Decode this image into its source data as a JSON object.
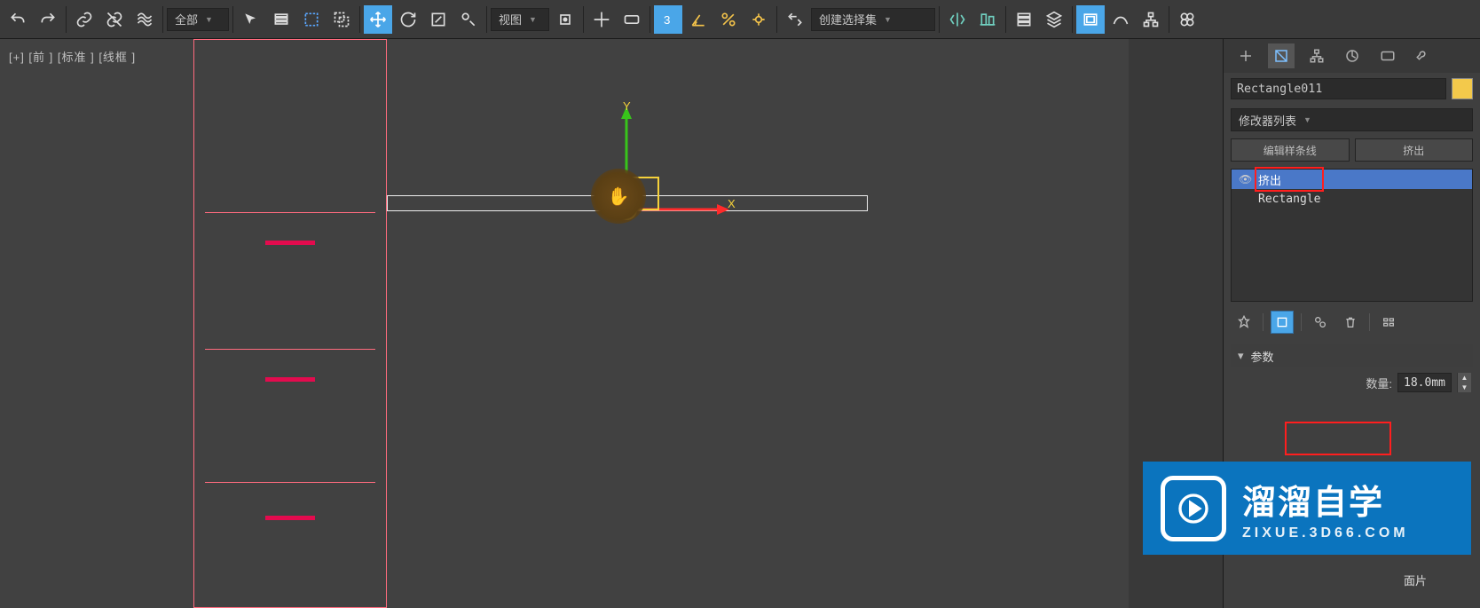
{
  "toolbar": {
    "filter_label": "全部",
    "view_label": "视图",
    "selectset_label": "创建选择集",
    "three_label": "3"
  },
  "viewport": {
    "label": "[+] [前 ] [标准 ] [线框 ]",
    "axis_x": "X",
    "axis_y": "Y"
  },
  "panel": {
    "object_name": "Rectangle011",
    "modlist_label": "修改器列表",
    "edit_spline": "编辑样条线",
    "extrude": "挤出",
    "stack": {
      "m0": "挤出",
      "m1": "Rectangle"
    },
    "rollout_params": "参数",
    "amount_label": "数量:",
    "amount_value": "18.0mm",
    "face_label": "面片"
  },
  "watermark": {
    "title": "溜溜自学",
    "url": "ZIXUE.3D66.COM"
  }
}
